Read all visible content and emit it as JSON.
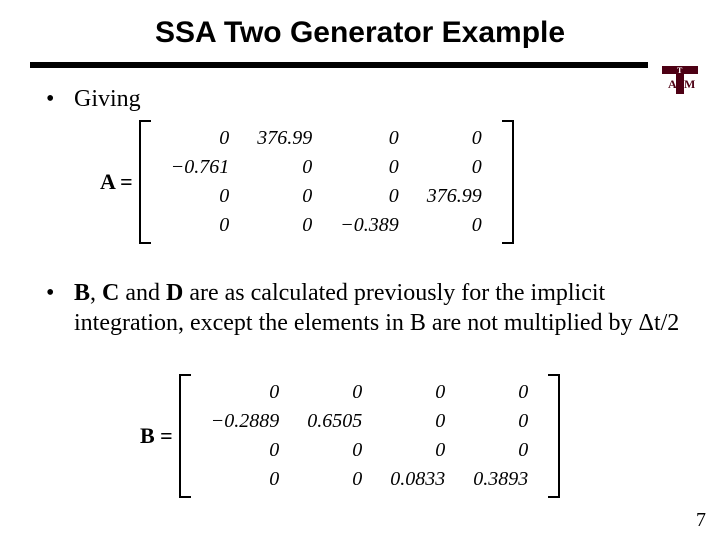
{
  "title": "SSA Two Generator Example",
  "logo": {
    "top_text": "A|M",
    "bottom_text": "T",
    "color": "#4d0014"
  },
  "bullets": {
    "b1": "Giving",
    "b2_pre": "B",
    "b2_mid1": ", ",
    "b2_c": "C",
    "b2_mid2": " and ",
    "b2_d": "D",
    "b2_rest": " are as calculated previously for the implicit integration, except the elements in B are not multiplied by Δt/2"
  },
  "matrixA": {
    "label": "A =",
    "rows": [
      [
        "0",
        "376.99",
        "0",
        "0"
      ],
      [
        "−0.761",
        "0",
        "0",
        "0"
      ],
      [
        "0",
        "0",
        "0",
        "376.99"
      ],
      [
        "0",
        "0",
        "−0.389",
        "0"
      ]
    ]
  },
  "matrixB": {
    "label": "B =",
    "rows": [
      [
        "0",
        "0",
        "0",
        "0"
      ],
      [
        "−0.2889",
        "0.6505",
        "0",
        "0"
      ],
      [
        "0",
        "0",
        "0",
        "0"
      ],
      [
        "0",
        "0",
        "0.0833",
        "0.3893"
      ]
    ]
  },
  "page_number": "7",
  "chart_data": [
    {
      "type": "table",
      "title": "Matrix A",
      "rows": [
        [
          0,
          376.99,
          0,
          0
        ],
        [
          -0.761,
          0,
          0,
          0
        ],
        [
          0,
          0,
          0,
          376.99
        ],
        [
          0,
          0,
          -0.389,
          0
        ]
      ]
    },
    {
      "type": "table",
      "title": "Matrix B",
      "rows": [
        [
          0,
          0,
          0,
          0
        ],
        [
          -0.2889,
          0.6505,
          0,
          0
        ],
        [
          0,
          0,
          0,
          0
        ],
        [
          0,
          0,
          0.0833,
          0.3893
        ]
      ]
    }
  ]
}
